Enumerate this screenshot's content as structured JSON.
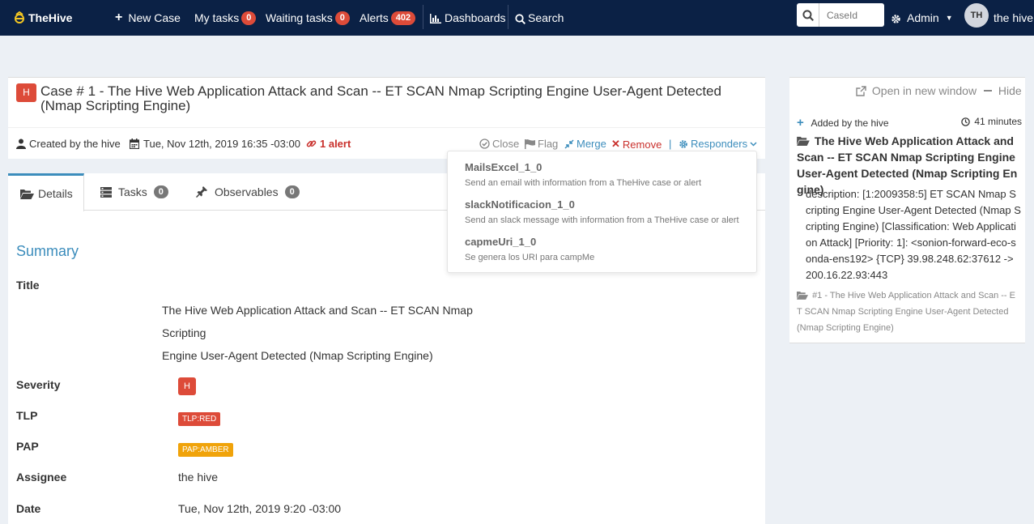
{
  "nav": {
    "logo": "TheHive",
    "new_case": "New Case",
    "my_tasks": "My tasks",
    "my_tasks_count": "0",
    "waiting_tasks": "Waiting tasks",
    "waiting_tasks_count": "0",
    "alerts": "Alerts",
    "alerts_count": "402",
    "dashboards": "Dashboards",
    "search": "Search",
    "caseid_placeholder": "CaseId",
    "admin": "Admin",
    "avatar_initials": "TH",
    "user": "the hive"
  },
  "case": {
    "severity": "H",
    "title": "Case # 1 - The Hive Web Application Attack and Scan -- ET SCAN Nmap Scripting Engine User-Agent Detected (Nmap Scripting Engine)",
    "created_by": "Created by the hive",
    "created_date": "Tue, Nov 12th, 2019 16:35 -03:00",
    "alerts": "1 alert",
    "actions": {
      "close": "Close",
      "flag": "Flag",
      "merge": "Merge",
      "remove": "Remove",
      "responders": "Responders"
    }
  },
  "tabs": [
    {
      "label": "Details"
    },
    {
      "label": "Tasks",
      "count": "0"
    },
    {
      "label": "Observables",
      "count": "0"
    }
  ],
  "details": {
    "summary": "Summary",
    "title_label": "Title",
    "title_line1": "The Hive Web Application Attack and Scan -- ET SCAN Nmap Scripting",
    "title_line2": "Engine User-Agent Detected (Nmap Scripting Engine)",
    "severity_label": "Severity",
    "severity_value": "H",
    "tlp_label": "TLP",
    "tlp_value": "TLP:RED",
    "pap_label": "PAP",
    "pap_value": "PAP:AMBER",
    "assignee_label": "Assignee",
    "assignee_value": "the hive",
    "date_label": "Date",
    "date_value": "Tue, Nov 12th, 2019 9:20 -03:00"
  },
  "responders": [
    {
      "name": "MailsExcel_1_0",
      "desc": "Send an email with information from a TheHive case or alert"
    },
    {
      "name": "slackNotificacion_1_0",
      "desc": "Send an slack message with information from a TheHive case or alert"
    },
    {
      "name": "capmeUri_1_0",
      "desc": "Se genera los URI para campMe"
    }
  ],
  "alert_panel": {
    "open_new_window": "Open in new window",
    "hide": "Hide",
    "added_by": "Added by the hive",
    "time_ago": "41 minutes",
    "title": "The Hive Web Application Attack and Scan -- ET SCAN Nmap Scripting Engine User-Agent Detected (Nmap Scripting Engine)",
    "description": "description: [1:2009358:5] ET SCAN Nmap Scripting Engine User-Agent Detected (Nmap Scripting Engine) [Classification: Web Application Attack] [Priority: 1]: <sonion-forward-eco-sonda-ens192> {TCP} 39.98.248.62:37612 -> 200.16.22.93:443",
    "case_ref": "#1 - The Hive Web Application Attack and Scan -- ET SCAN Nmap Scripting Engine User-Agent Detected (Nmap Scripting Engine)"
  },
  "colors": {
    "navbar": "#0b2145",
    "severity_high": "#dd4b39",
    "tlp_red": "#dd4b39",
    "pap_amber": "#f0a30a",
    "link_blue": "#3c8dbc"
  }
}
